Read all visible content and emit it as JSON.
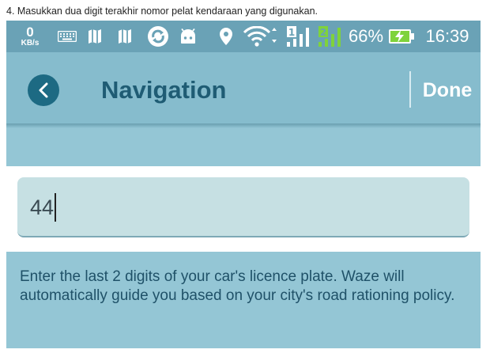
{
  "caption": "4. Masukkan dua digit terakhir nomor pelat kendaraan yang digunakan.",
  "status_bar": {
    "speed_value": "0",
    "speed_unit": "KB/s",
    "icons": [
      "keyboard-icon",
      "map-icon",
      "map-icon",
      "sync-icon",
      "android-icon",
      "location-icon",
      "wifi-icon",
      "signal-sim1-icon",
      "signal-sim2-icon",
      "battery-charging-icon"
    ],
    "sim1_label": "1",
    "sim2_label": "2",
    "battery_percent": "66%",
    "time": "16:39"
  },
  "header": {
    "title": "Navigation",
    "done_label": "Done"
  },
  "plate_input": {
    "value": "44"
  },
  "info_text": "Enter the last 2 digits of your car's licence plate. Waze will automatically guide you based on your city's road rationing policy.",
  "colors": {
    "status_bar_bg": "#6aa2b6",
    "header_bg": "#86bccd",
    "title_color": "#1f5c74",
    "back_button_bg": "#1d6a83",
    "input_bg": "#c6e0e3",
    "info_bg": "#94c6d5",
    "battery_accent": "#7fd33b",
    "sim2_accent": "#7fd33b"
  }
}
